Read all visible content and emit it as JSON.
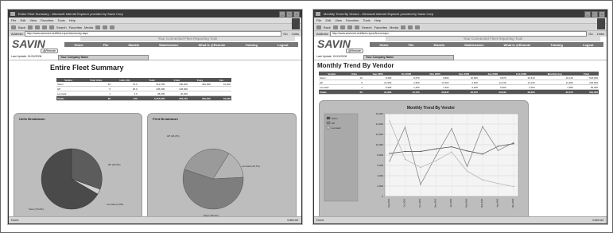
{
  "left": {
    "window_title": "Entire Fleet Summary - Microsoft Internet Explorer provided by Savin Corp",
    "menu": [
      "File",
      "Edit",
      "View",
      "Favorites",
      "Tools",
      "Help"
    ],
    "toolbar": [
      "Back",
      "Search",
      "Favorites",
      "Media"
    ],
    "address_label": "Address",
    "address_url": "http://www.savinnet.net/fleet-report/summary.aspx",
    "go_label": "Go",
    "links_label": "Links",
    "status_left": "Done",
    "status_right": "Internet",
    "logo": "SAVIN",
    "tagline": "Your Connected Fleet Reporting Tool!",
    "nav": [
      "Home",
      "File",
      "Models",
      "Maintenance",
      "What Is @Remote",
      "Training",
      "Logout"
    ],
    "tab": "@Remote",
    "last_login": "Last Update: 01/24/2006",
    "company": "Your Company Name",
    "page_title": "Entire Fleet Summary",
    "table": {
      "headers": [
        "Vendor",
        "Total Units",
        "Units (%)",
        "Total",
        "Color",
        "Copy",
        "Fax"
      ],
      "rows": [
        [
          "Savin",
          "19",
          "76.0",
          "312,000",
          "190,000",
          "400,000",
          "61,000"
        ],
        [
          "HP",
          "5",
          "20.0",
          "236,000",
          "136,000",
          "",
          ""
        ],
        [
          "Lexmark",
          "1",
          "4.0",
          "68,000",
          "40,000",
          "",
          ""
        ]
      ],
      "total": [
        "Totals",
        "25",
        "100",
        "5,215,000",
        "591,110",
        "305,200",
        "61,228"
      ]
    },
    "units_panel": {
      "title": "Units Breakdown",
      "labels": [
        "HP (20.0%)",
        "Savin (76.0%)",
        "Lexmark (4.0%)"
      ]
    },
    "print_panel": {
      "title": "Print Breakdown",
      "labels": [
        "HP (20.2%)",
        "Lexmark (10.7%)",
        "Savin (69.1%)"
      ]
    },
    "colors": {
      "dark": "#555555",
      "mid": "#888888",
      "light": "#bdbdbd"
    }
  },
  "right": {
    "window_title": "Monthly Trend By Vendor - Microsoft Internet Explorer provided by Savin Corp",
    "menu": [
      "File",
      "Edit",
      "View",
      "Favorites",
      "Tools",
      "Help"
    ],
    "toolbar": [
      "Back",
      "Search",
      "Favorites",
      "Media"
    ],
    "address_label": "Address",
    "address_url": "http://www.savinnet.net/fleet-report/trend.aspx",
    "go_label": "Go",
    "links_label": "Links",
    "status_left": "Done",
    "status_right": "Internet",
    "logo": "SAVIN",
    "tagline": "Your Connected Fleet Reporting Tool!",
    "nav": [
      "Home",
      "File",
      "Models",
      "Maintenance",
      "What Is @Remote",
      "Training",
      "Logout"
    ],
    "tab": "@Remote",
    "last_login": "Last Update: 01/24/2006",
    "company": "Your Company Name",
    "page_title": "Monthly Trend By Vendor",
    "table": {
      "headers": [
        "Vendor",
        "Units",
        "Sep 2005",
        "Oct 2005",
        "Nov 2005",
        "Dec 2005",
        "Jan 2006",
        "Feb 2006",
        "Monthly Avg",
        "Total"
      ],
      "rows": [
        [
          "Savin",
          "19",
          "8,300",
          "8,670",
          "9,890",
          "10,820",
          "9,870",
          "10,310",
          "10,140",
          "518,000"
        ],
        [
          "HP",
          "5",
          "21,500",
          "2,600",
          "13,400",
          "2,600",
          "12,130",
          "13,130",
          "11,480",
          "236,000"
        ],
        [
          "Lexmark",
          "1",
          "8,990",
          "1,400",
          "7,300",
          "5,600",
          "6,600",
          "3,200",
          "7,980",
          "56,000"
        ]
      ],
      "total": [
        "Totals",
        "25",
        "31,900",
        "12,720",
        "30,840",
        "22,270",
        "29,640",
        "36,250",
        "30,724",
        "591,000"
      ]
    },
    "trend_chart": {
      "title": "Monthly Trend By Vendor",
      "legend": [
        "Savin",
        "HP",
        "Lexmark"
      ]
    }
  },
  "chart_data": {
    "type": "line",
    "title": "Monthly Trend By Vendor",
    "ylim": [
      0,
      16000
    ],
    "y_ticks": [
      "16,000",
      "14,000",
      "12,000",
      "10,000",
      "8,000",
      "6,000",
      "4,000",
      "2,000",
      "0"
    ],
    "categories": [
      "Sep 2005",
      "Oct 2005",
      "Nov 2005",
      "Dec 2005",
      "Jan 2006",
      "Feb 2006",
      "Mar 2006",
      "Apr 2006",
      "May 2006"
    ],
    "series": [
      {
        "name": "Savin",
        "values": [
          8300,
          8700,
          8700,
          9200,
          9600,
          8800,
          8200,
          9700,
          10200
        ]
      },
      {
        "name": "HP",
        "values": [
          6800,
          13400,
          2300,
          7900,
          13100,
          5800,
          13500,
          8900,
          10400
        ]
      },
      {
        "name": "Lexmark",
        "values": [
          14600,
          7200,
          5600,
          6900,
          8600,
          4900,
          3200,
          2500,
          1900
        ]
      }
    ],
    "grid": true,
    "legend_position": "left"
  }
}
